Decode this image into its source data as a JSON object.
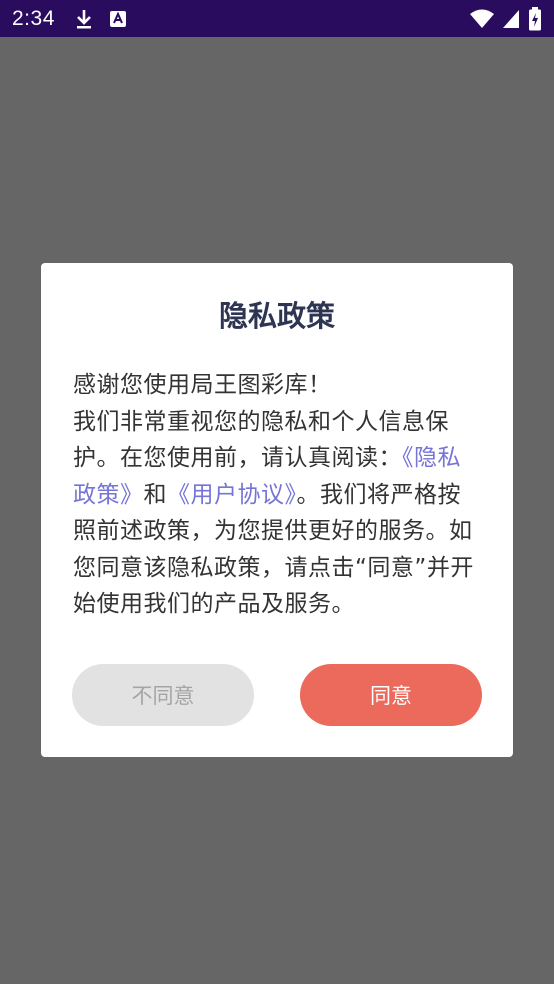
{
  "status_bar": {
    "time": "2:34",
    "icons_left": [
      "download-icon",
      "a-box-icon"
    ],
    "icons_right": [
      "wifi-icon",
      "signal-icon",
      "battery-icon"
    ],
    "background": "#2a0c5e"
  },
  "dialog": {
    "title": "隐私政策",
    "body": {
      "line1": "感谢您使用局王图彩库！",
      "part1": "我们非常重视您的隐私和个人信息保护。在您使用前，请认真阅读：",
      "privacy_link": "《隐私政策》",
      "and": "和",
      "user_link": "《用户协议》",
      "part2": "。我们将严格按照前述政策，为您提供更好的服务。如您同意该隐私政策，请点击“同意”并开始使用我们的产品及服务。"
    },
    "disagree_label": "不同意",
    "agree_label": "同意"
  },
  "colors": {
    "accent": "#eb6a5c",
    "link": "#7674d6",
    "overlay": "#666666"
  }
}
